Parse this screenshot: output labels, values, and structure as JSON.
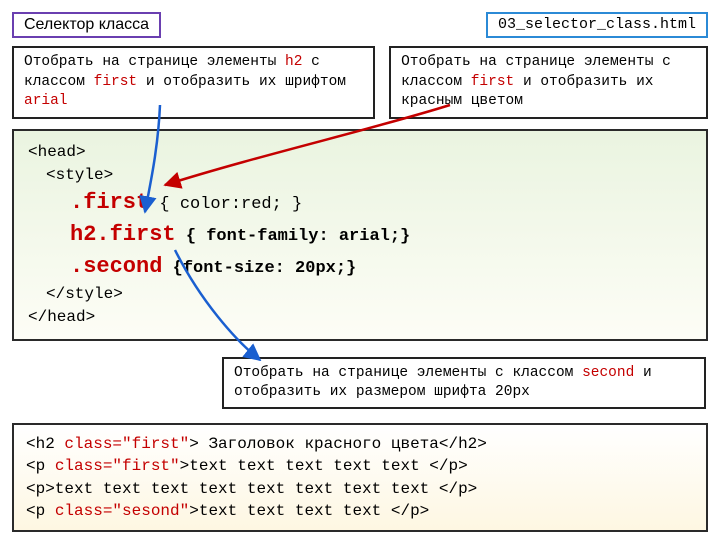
{
  "header": {
    "title": "Селектор класса",
    "filename": "03_selector_class.html"
  },
  "callout_left": {
    "pre1": "Отобрать на странице  элементы ",
    "h2": "h2",
    "mid1": " с классом ",
    "first": "first",
    "post1": " и отобразить их шрифтом ",
    "arial": "arial"
  },
  "callout_right": {
    "pre1": "Отобрать на странице элементы с классом ",
    "first": "first",
    "post1": " и отобразить их красным цветом"
  },
  "code": {
    "head_open": "<head>",
    "style_open": "<style>",
    "sel1": ".first",
    "rule1": " { color:red; }",
    "sel2": "h2.first",
    "rule2": " { font-family: arial;}",
    "sel3": ".second",
    "rule3": " {font-size: 20px;}",
    "style_close": "</style>",
    "head_close": "</head>"
  },
  "callout_bottom": {
    "pre1": "Отобрать на странице  элементы с классом ",
    "second": "second",
    "post1": " и отобразить их размером шрифта 20px"
  },
  "html": {
    "l1a": "<h2 ",
    "l1b": "class=\"first\"",
    "l1c": "> Заголовок красного цвета</h2>",
    "l2a": "<p ",
    "l2b": "class=\"first\"",
    "l2c": ">text text text text text </p>",
    "l3": "<p>text text text text text text text text </p>",
    "l4a": "<p ",
    "l4b": "class=\"sesond\"",
    "l4c": ">text text text text </p>"
  }
}
